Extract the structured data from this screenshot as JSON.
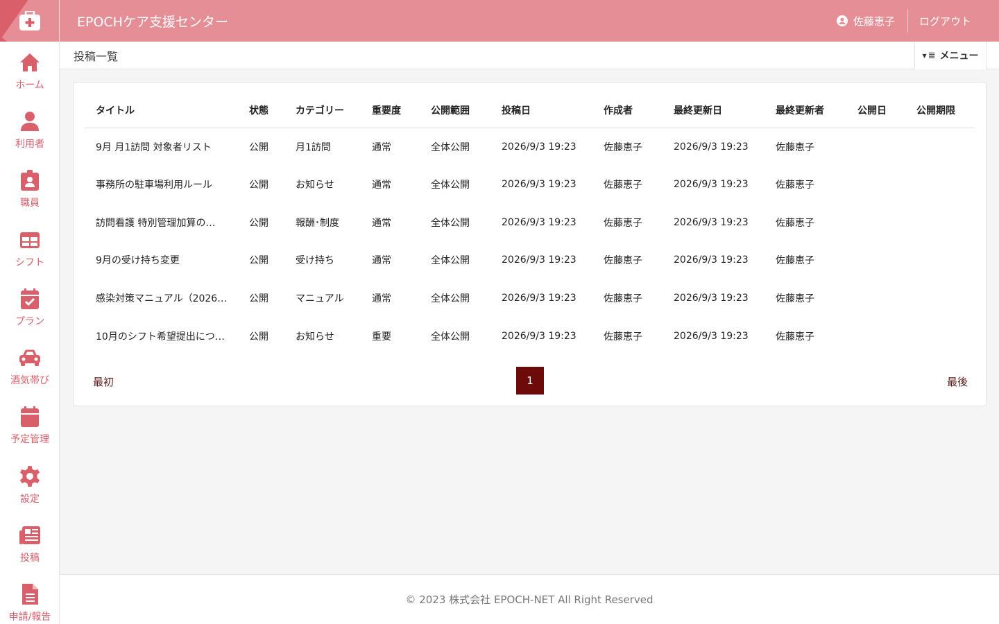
{
  "app": {
    "title": "EPOCHケア支援センター"
  },
  "user": {
    "name": "佐藤恵子",
    "logout_label": "ログアウト"
  },
  "page": {
    "title": "投稿一覧",
    "menu_label": "メニュー"
  },
  "sidebar": {
    "items": [
      {
        "label": "ホーム",
        "icon": "home-icon"
      },
      {
        "label": "利用者",
        "icon": "user-icon"
      },
      {
        "label": "職員",
        "icon": "badge-icon"
      },
      {
        "label": "シフト",
        "icon": "table-icon"
      },
      {
        "label": "プラン",
        "icon": "calendar-check-icon"
      },
      {
        "label": "酒気帯び",
        "icon": "car-icon"
      },
      {
        "label": "予定管理",
        "icon": "calendar-icon"
      },
      {
        "label": "設定",
        "icon": "gear-icon"
      },
      {
        "label": "投稿",
        "icon": "newspaper-icon"
      },
      {
        "label": "申請/報告",
        "icon": "document-icon"
      }
    ]
  },
  "table": {
    "headers": [
      "タイトル",
      "状態",
      "カテゴリー",
      "重要度",
      "公開範囲",
      "投稿日",
      "作成者",
      "最終更新日",
      "最終更新者",
      "公開日",
      "公開期限"
    ],
    "rows": [
      [
        "9月 月1訪問 対象者リスト",
        "公開",
        "月1訪問",
        "通常",
        "全体公開",
        "2026/9/3 19:23",
        "佐藤恵子",
        "2026/9/3 19:23",
        "佐藤恵子",
        "",
        ""
      ],
      [
        "事務所の駐車場利用ルール",
        "公開",
        "お知らせ",
        "通常",
        "全体公開",
        "2026/9/3 19:23",
        "佐藤恵子",
        "2026/9/3 19:23",
        "佐藤恵子",
        "",
        ""
      ],
      [
        "訪問看護 特別管理加算の…",
        "公開",
        "報酬･制度",
        "通常",
        "全体公開",
        "2026/9/3 19:23",
        "佐藤恵子",
        "2026/9/3 19:23",
        "佐藤恵子",
        "",
        ""
      ],
      [
        "9月の受け持ち変更",
        "公開",
        "受け持ち",
        "通常",
        "全体公開",
        "2026/9/3 19:23",
        "佐藤恵子",
        "2026/9/3 19:23",
        "佐藤恵子",
        "",
        ""
      ],
      [
        "感染対策マニュアル（2026…",
        "公開",
        "マニュアル",
        "通常",
        "全体公開",
        "2026/9/3 19:23",
        "佐藤恵子",
        "2026/9/3 19:23",
        "佐藤恵子",
        "",
        ""
      ],
      [
        "10月のシフト希望提出につ…",
        "公開",
        "お知らせ",
        "重要",
        "全体公開",
        "2026/9/3 19:23",
        "佐藤恵子",
        "2026/9/3 19:23",
        "佐藤恵子",
        "",
        ""
      ]
    ]
  },
  "pager": {
    "first_label": "最初",
    "current_page": "1",
    "last_label": "最後"
  },
  "footer": {
    "copyright": "© 2023 株式会社 EPOCH-NET All Right Reserved"
  },
  "colors": {
    "brand": "#d9606b",
    "header": "#e68e96",
    "pager_active": "#6d0a0a"
  }
}
